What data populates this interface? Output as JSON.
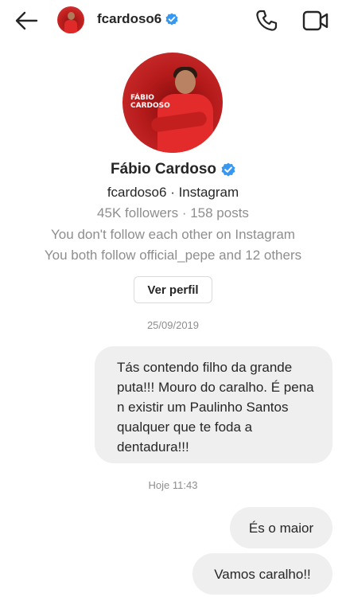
{
  "header": {
    "username": "fcardoso6",
    "back_icon": "arrow-left-icon",
    "call_icon": "phone-icon",
    "video_icon": "video-camera-icon"
  },
  "profile": {
    "name": "Fábio Cardoso",
    "avatar_text": "FÁBIO CARDOSO",
    "handle_line": "fcardoso6 · Instagram",
    "stats_line": "45K followers · 158 posts",
    "follow_line_1": "You don't follow each other on Instagram",
    "follow_line_2": "You both follow official_pepe and 12 others",
    "view_profile_label": "Ver perfil"
  },
  "colors": {
    "verified_badge": "#3897f0",
    "bubble_bg": "#efefef",
    "secondary_text": "#8e8e8e",
    "avatar_red": "#c42020"
  },
  "thread": {
    "date_1": "25/09/2019",
    "message_1": "Tás contendo filho da grande puta!!! Mouro do caralho. É pena n existir um Paulinho Santos qualquer que te foda a dentadura!!!",
    "date_2": "Hoje 11:43",
    "message_2": "És o maior",
    "message_3": "Vamos caralho!!"
  }
}
